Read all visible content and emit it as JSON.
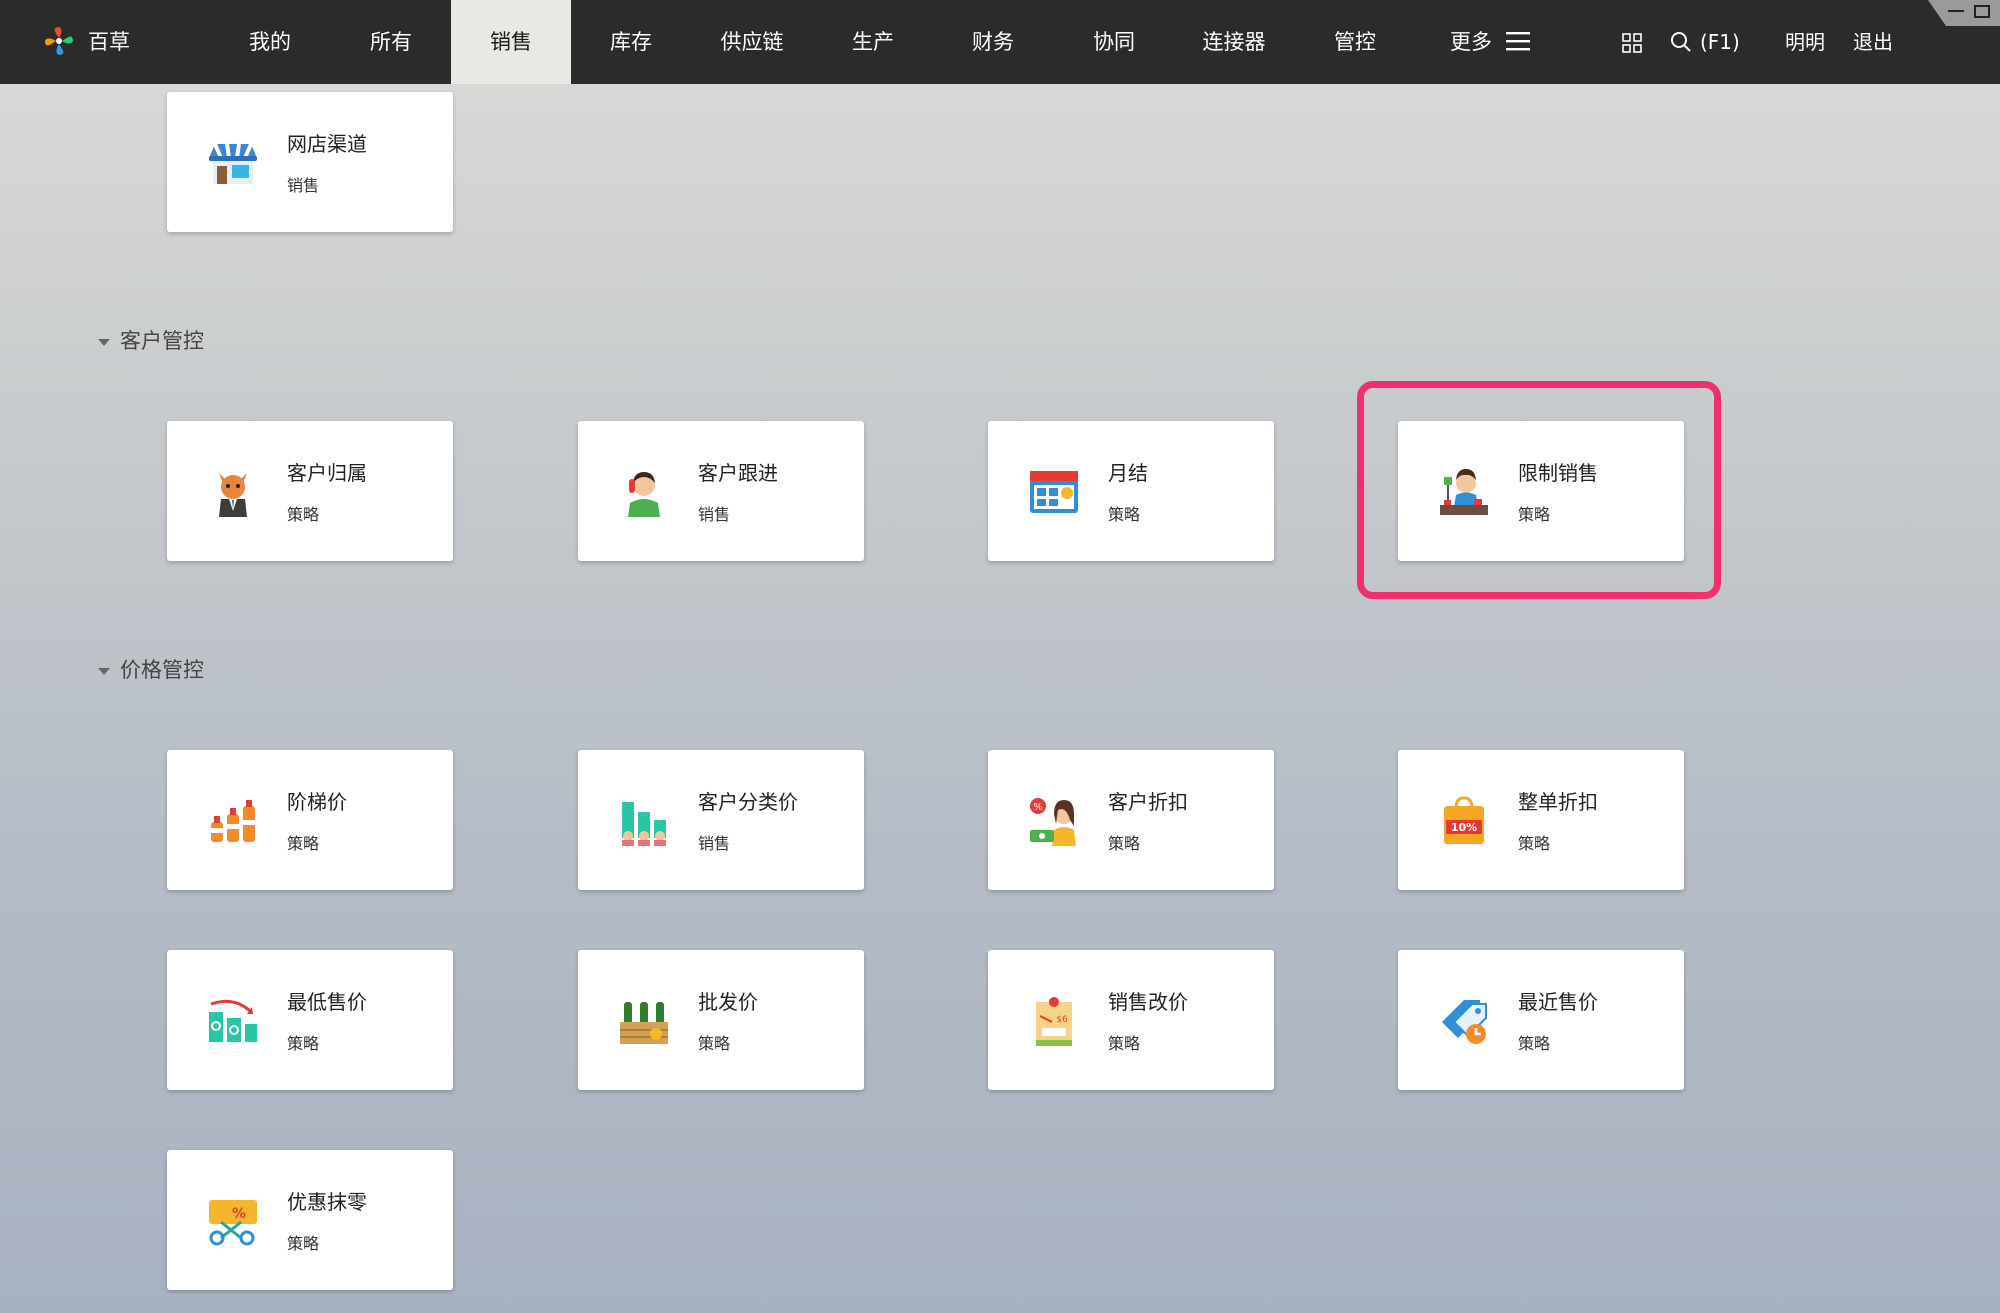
{
  "app": {
    "brand": "百草"
  },
  "nav": {
    "tabs": [
      {
        "label": "我的"
      },
      {
        "label": "所有"
      },
      {
        "label": "销售"
      },
      {
        "label": "库存"
      },
      {
        "label": "供应链"
      },
      {
        "label": "生产"
      },
      {
        "label": "财务"
      },
      {
        "label": "协同"
      },
      {
        "label": "连接器"
      },
      {
        "label": "管控"
      },
      {
        "label": "更多"
      }
    ],
    "active_tab": "销售",
    "search_hint": "(F1)",
    "user": "明明",
    "logout": "退出"
  },
  "cards": [
    {
      "title": "网店渠道",
      "sub": "销售",
      "icon": "online-store-icon"
    },
    {
      "title": "客户归属",
      "sub": "策略",
      "icon": "cat-businessman-icon"
    },
    {
      "title": "客户跟进",
      "sub": "销售",
      "icon": "phone-call-person-icon"
    },
    {
      "title": "月结",
      "sub": "策略",
      "icon": "calendar-icon"
    },
    {
      "title": "限制销售",
      "sub": "策略",
      "icon": "seller-counter-icon"
    },
    {
      "title": "阶梯价",
      "sub": "策略",
      "icon": "bottles-icon"
    },
    {
      "title": "客户分类价",
      "sub": "销售",
      "icon": "customer-chart-icon"
    },
    {
      "title": "客户折扣",
      "sub": "策略",
      "icon": "discount-person-icon"
    },
    {
      "title": "整单折扣",
      "sub": "策略",
      "icon": "shopping-bag-discount-icon"
    },
    {
      "title": "最低售价",
      "sub": "策略",
      "icon": "price-down-icon"
    },
    {
      "title": "批发价",
      "sub": "策略",
      "icon": "wholesale-bottles-icon"
    },
    {
      "title": "销售改价",
      "sub": "策略",
      "icon": "price-tag-icon"
    },
    {
      "title": "最近售价",
      "sub": "策略",
      "icon": "recent-price-tag-icon"
    },
    {
      "title": "优惠抹零",
      "sub": "策略",
      "icon": "coupon-scissors-icon"
    }
  ],
  "sections": [
    {
      "label": "客户管控"
    },
    {
      "label": "价格管控"
    }
  ]
}
